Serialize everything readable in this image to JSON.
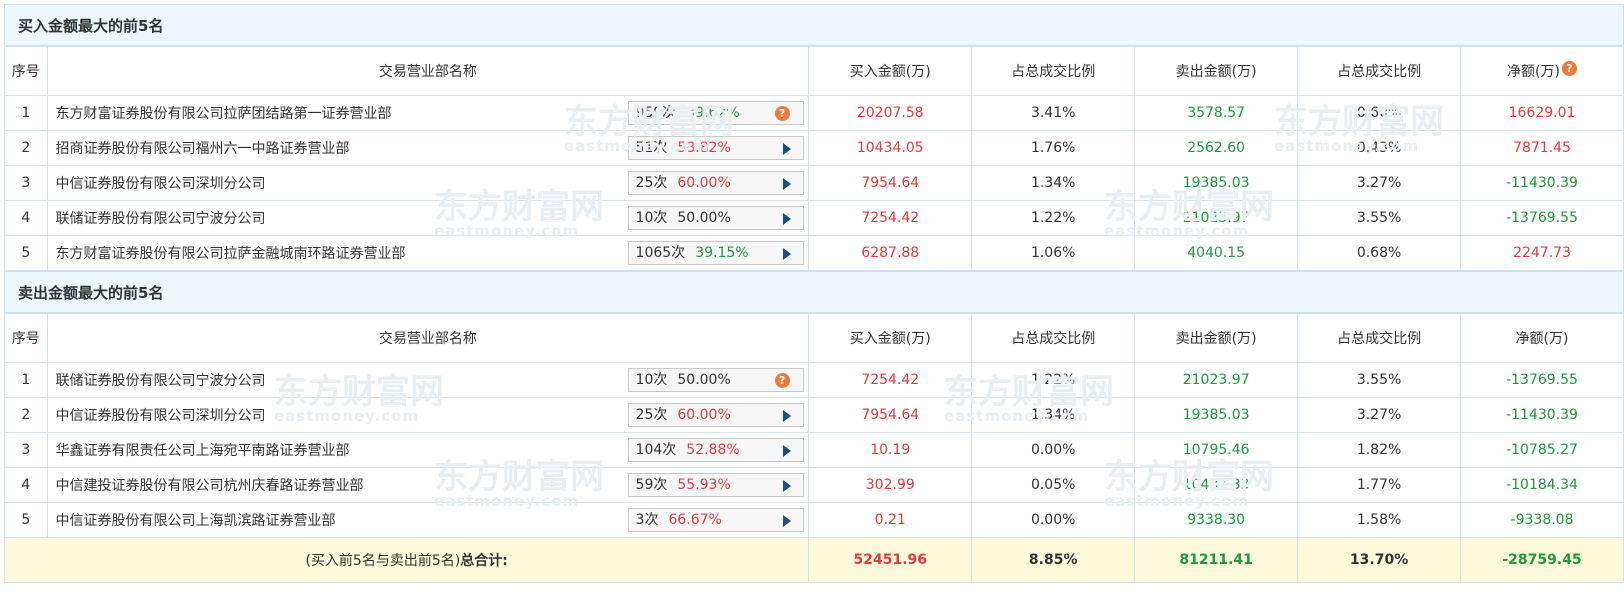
{
  "top_buy": {
    "title": "买入金额最大的前5名",
    "headers": [
      "序号",
      "交易营业部名称",
      "买入金额(万)",
      "占总成交比例",
      "卖出金额(万)",
      "占总成交比例",
      "净额(万)"
    ],
    "rows": [
      {
        "idx": "1",
        "name": "东方财富证券股份有限公司拉萨团结路第一证券营业部",
        "times": "959次",
        "rate": "39.62%",
        "rate_color": "green",
        "icon": "question-icon",
        "buy": "20207.58",
        "buy_pct": "3.41%",
        "sell": "3578.57",
        "sell_pct": "0.60%",
        "net": "16629.01",
        "net_color": "red"
      },
      {
        "idx": "2",
        "name": "招商证券股份有限公司福州六一中路证券营业部",
        "times": "51次",
        "rate": "58.82%",
        "rate_color": "red",
        "icon": "play-icon",
        "buy": "10434.05",
        "buy_pct": "1.76%",
        "sell": "2562.60",
        "sell_pct": "0.43%",
        "net": "7871.45",
        "net_color": "red"
      },
      {
        "idx": "3",
        "name": "中信证券股份有限公司深圳分公司",
        "times": "25次",
        "rate": "60.00%",
        "rate_color": "red",
        "icon": "play-icon",
        "buy": "7954.64",
        "buy_pct": "1.34%",
        "sell": "19385.03",
        "sell_pct": "3.27%",
        "net": "-11430.39",
        "net_color": "green"
      },
      {
        "idx": "4",
        "name": "联储证券股份有限公司宁波分公司",
        "times": "10次",
        "rate": "50.00%",
        "rate_color": "dark",
        "icon": "play-icon",
        "buy": "7254.42",
        "buy_pct": "1.22%",
        "sell": "21023.97",
        "sell_pct": "3.55%",
        "net": "-13769.55",
        "net_color": "green"
      },
      {
        "idx": "5",
        "name": "东方财富证券股份有限公司拉萨金融城南环路证券营业部",
        "times": "1065次",
        "rate": "39.15%",
        "rate_color": "green",
        "icon": "play-icon",
        "buy": "6287.88",
        "buy_pct": "1.06%",
        "sell": "4040.15",
        "sell_pct": "0.68%",
        "net": "2247.73",
        "net_color": "red"
      }
    ]
  },
  "top_sell": {
    "title": "卖出金额最大的前5名",
    "headers": [
      "序号",
      "交易营业部名称",
      "买入金额(万)",
      "占总成交比例",
      "卖出金额(万)",
      "占总成交比例",
      "净额(万)"
    ],
    "rows": [
      {
        "idx": "1",
        "name": "联储证券股份有限公司宁波分公司",
        "times": "10次",
        "rate": "50.00%",
        "rate_color": "dark",
        "icon": "question-icon",
        "buy": "7254.42",
        "buy_pct": "1.22%",
        "sell": "21023.97",
        "sell_pct": "3.55%",
        "net": "-13769.55",
        "net_color": "green"
      },
      {
        "idx": "2",
        "name": "中信证券股份有限公司深圳分公司",
        "times": "25次",
        "rate": "60.00%",
        "rate_color": "red",
        "icon": "play-icon",
        "buy": "7954.64",
        "buy_pct": "1.34%",
        "sell": "19385.03",
        "sell_pct": "3.27%",
        "net": "-11430.39",
        "net_color": "green"
      },
      {
        "idx": "3",
        "name": "华鑫证券有限责任公司上海宛平南路证券营业部",
        "times": "104次",
        "rate": "52.88%",
        "rate_color": "red",
        "icon": "play-icon",
        "buy": "10.19",
        "buy_pct": "0.00%",
        "sell": "10795.46",
        "sell_pct": "1.82%",
        "net": "-10785.27",
        "net_color": "green"
      },
      {
        "idx": "4",
        "name": "中信建投证券股份有限公司杭州庆春路证券营业部",
        "times": "59次",
        "rate": "55.93%",
        "rate_color": "red",
        "icon": "play-icon",
        "buy": "302.99",
        "buy_pct": "0.05%",
        "sell": "10487.33",
        "sell_pct": "1.77%",
        "net": "-10184.34",
        "net_color": "green"
      },
      {
        "idx": "5",
        "name": "中信证券股份有限公司上海凯滨路证券营业部",
        "times": "3次",
        "rate": "66.67%",
        "rate_color": "red",
        "icon": "play-icon",
        "buy": "0.21",
        "buy_pct": "0.00%",
        "sell": "9338.30",
        "sell_pct": "1.58%",
        "net": "-9338.08",
        "net_color": "green"
      }
    ]
  },
  "total": {
    "label_prefix": "(买入前5名与卖出前5名)",
    "label_bold": "总合计:",
    "buy": "52451.96",
    "buy_pct": "8.85%",
    "sell": "81211.41",
    "sell_pct": "13.70%",
    "net": "-28759.45"
  },
  "net_help_icon": "question-icon",
  "watermark": {
    "cn": "东方财富网",
    "en": "eastmoney.com"
  },
  "colors": {
    "red": "#e33b3b",
    "green": "#1f9a3a",
    "header_bg": "#eef6fe",
    "total_bg": "#fdf9db",
    "icon_orange": "#f07a38",
    "play_blue": "#1f4b87"
  }
}
